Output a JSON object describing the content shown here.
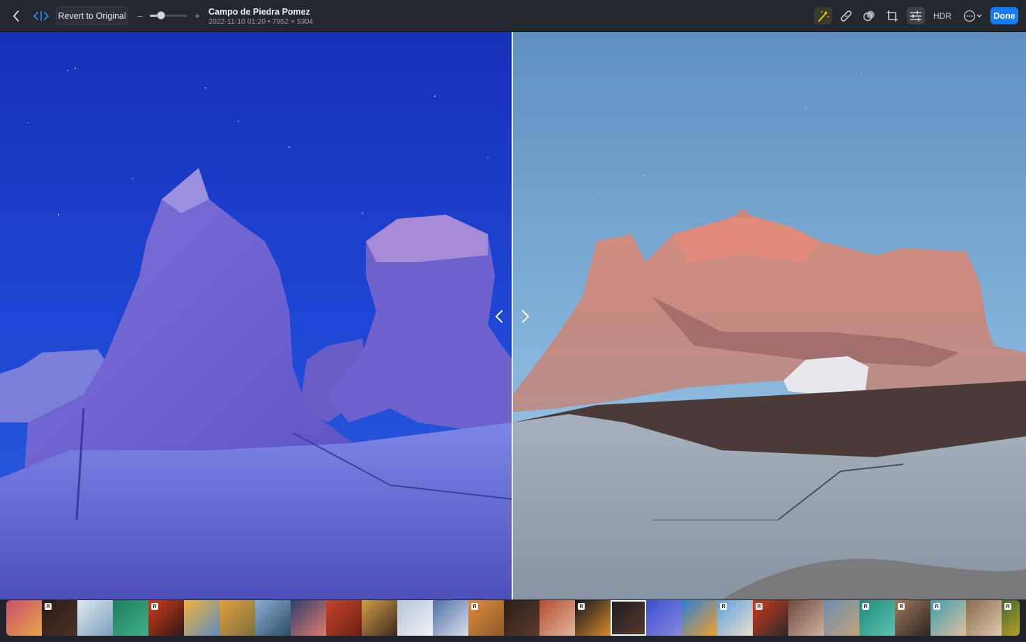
{
  "toolbar": {
    "revert_label": "Revert to Original",
    "zoom_minus": "–",
    "zoom_plus": "+",
    "zoom_level": 0.3,
    "title": "Campo de Piedra Pomez",
    "subtitle": "2022-11-10 01:20 • 7952 × 5304",
    "hdr_label": "HDR",
    "done_label": "Done",
    "tools": [
      "auto-enhance-icon",
      "retouch-icon",
      "filters-icon",
      "crop-icon",
      "adjust-icon"
    ]
  },
  "colors": {
    "accent": "#1a7cf5",
    "auto_enhance": "#f5c518",
    "left_sky": "#1f3ec9",
    "right_sky": "#7fb2dc"
  },
  "filmstrip": {
    "current_index": 17,
    "thumbs": [
      {
        "badge": ""
      },
      {
        "badge": "R"
      },
      {
        "badge": ""
      },
      {
        "badge": ""
      },
      {
        "badge": "R"
      },
      {
        "badge": ""
      },
      {
        "badge": ""
      },
      {
        "badge": ""
      },
      {
        "badge": ""
      },
      {
        "badge": ""
      },
      {
        "badge": ""
      },
      {
        "badge": ""
      },
      {
        "badge": ""
      },
      {
        "badge": "R"
      },
      {
        "badge": ""
      },
      {
        "badge": ""
      },
      {
        "badge": "R"
      },
      {
        "badge": ""
      },
      {
        "badge": ""
      },
      {
        "badge": ""
      },
      {
        "badge": "R"
      },
      {
        "badge": "R"
      },
      {
        "badge": ""
      },
      {
        "badge": ""
      },
      {
        "badge": "R"
      },
      {
        "badge": "R"
      },
      {
        "badge": "R"
      },
      {
        "badge": ""
      },
      {
        "badge": "R"
      }
    ]
  }
}
